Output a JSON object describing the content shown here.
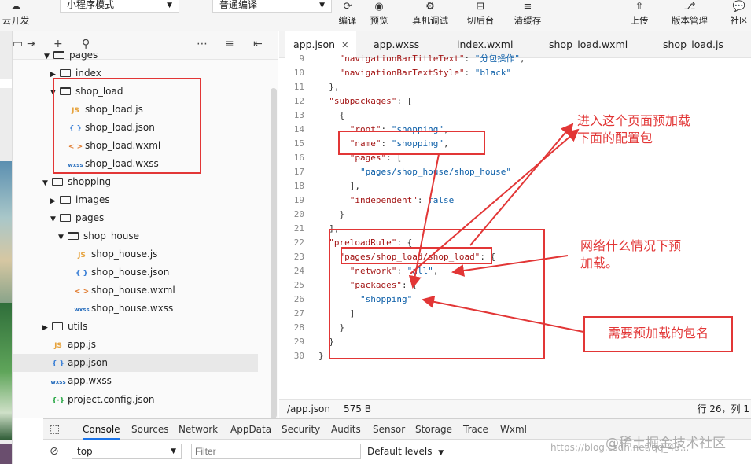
{
  "toolbar": {
    "cloud_label": "云开发",
    "mode_select": "小程序模式",
    "compile_select": "普通编译",
    "buttons": [
      "编译",
      "预览",
      "真机调试",
      "切后台",
      "清缓存",
      "上传",
      "版本管理",
      "社区"
    ]
  },
  "explorer": {
    "tree": [
      {
        "label": "pages",
        "kind": "folder",
        "open": true
      },
      {
        "label": "index",
        "kind": "folder",
        "open": false
      },
      {
        "label": "shop_load",
        "kind": "folder",
        "open": true
      },
      {
        "label": "shop_load.js",
        "kind": "js"
      },
      {
        "label": "shop_load.json",
        "kind": "json"
      },
      {
        "label": "shop_load.wxml",
        "kind": "wxml"
      },
      {
        "label": "shop_load.wxss",
        "kind": "wxss"
      },
      {
        "label": "shopping",
        "kind": "folder",
        "open": true
      },
      {
        "label": "images",
        "kind": "folder",
        "open": false
      },
      {
        "label": "pages",
        "kind": "folder",
        "open": true
      },
      {
        "label": "shop_house",
        "kind": "folder",
        "open": true
      },
      {
        "label": "shop_house.js",
        "kind": "js"
      },
      {
        "label": "shop_house.json",
        "kind": "json"
      },
      {
        "label": "shop_house.wxml",
        "kind": "wxml"
      },
      {
        "label": "shop_house.wxss",
        "kind": "wxss"
      },
      {
        "label": "utils",
        "kind": "folder",
        "open": false
      },
      {
        "label": "app.js",
        "kind": "js"
      },
      {
        "label": "app.json",
        "kind": "json"
      },
      {
        "label": "app.wxss",
        "kind": "wxss"
      },
      {
        "label": "project.config.json",
        "kind": "cfg"
      }
    ],
    "file_icons": {
      "js": "JS",
      "json": "{ }",
      "wxml": "< >",
      "wxss": "wxss",
      "cfg": "{·}"
    }
  },
  "editor": {
    "tabs": [
      "app.json",
      "app.wxss",
      "index.wxml",
      "shop_load.wxml",
      "shop_load.js"
    ],
    "lines": [
      {
        "n": "9",
        "text": "    \"navigationBarTitleText\": \"分包操作\","
      },
      {
        "n": "10",
        "text": "    \"navigationBarTextStyle\": \"black\""
      },
      {
        "n": "11",
        "text": "  },"
      },
      {
        "n": "12",
        "text": "  \"subpackages\": ["
      },
      {
        "n": "13",
        "text": "    {"
      },
      {
        "n": "14",
        "text": "      \"root\": \"shopping\","
      },
      {
        "n": "15",
        "text": "      \"name\": \"shopping\","
      },
      {
        "n": "16",
        "text": "      \"pages\": ["
      },
      {
        "n": "17",
        "text": "        \"pages/shop_house/shop_house\""
      },
      {
        "n": "18",
        "text": "      ],"
      },
      {
        "n": "19",
        "text": "      \"independent\": false"
      },
      {
        "n": "20",
        "text": "    }"
      },
      {
        "n": "21",
        "text": "  ],"
      },
      {
        "n": "22",
        "text": "  \"preloadRule\": {"
      },
      {
        "n": "23",
        "text": "    \"pages/shop_load/shop_load\": {"
      },
      {
        "n": "24",
        "text": "      \"network\": \"all\","
      },
      {
        "n": "25",
        "text": "      \"packages\": ["
      },
      {
        "n": "26",
        "text": "        \"shopping\""
      },
      {
        "n": "27",
        "text": "      ]"
      },
      {
        "n": "28",
        "text": "    }"
      },
      {
        "n": "29",
        "text": "  }"
      },
      {
        "n": "30",
        "text": "}"
      }
    ],
    "status": {
      "path": "/app.json",
      "size": "575 B",
      "cursor": "行 26，列 1"
    }
  },
  "annotations": {
    "note1_line1": "进入这个页面预加载",
    "note1_line2": "下面的配置包",
    "note2_line1": "网络什么情况下预",
    "note2_line2": "加载。",
    "note3": "需要预加载的包名",
    "color": "#e23636"
  },
  "devtools": {
    "tabs": [
      "Console",
      "Sources",
      "Network",
      "AppData",
      "Security",
      "Audits",
      "Sensor",
      "Storage",
      "Trace",
      "Wxml"
    ],
    "context": "top",
    "filter_placeholder": "Filter",
    "levels": "Default levels"
  },
  "watermark": {
    "site": "@稀土掘金技术社区",
    "url": "https://blog.csdn.net/qq_43..."
  }
}
